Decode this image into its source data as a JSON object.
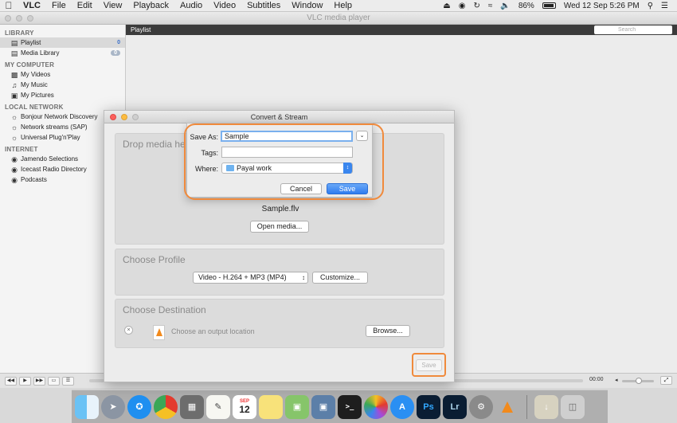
{
  "menubar": {
    "items": [
      "VLC",
      "File",
      "Edit",
      "View",
      "Playback",
      "Audio",
      "Video",
      "Subtitles",
      "Window",
      "Help"
    ],
    "battery": "86%",
    "clock": "Wed 12 Sep  5:26 PM"
  },
  "vlc": {
    "title": "VLC media player",
    "sidebar": {
      "library_header": "LIBRARY",
      "playlist": "Playlist",
      "playlist_count": "0",
      "media_library": "Media Library",
      "media_library_count": "0",
      "computer_header": "MY COMPUTER",
      "videos": "My Videos",
      "music": "My Music",
      "pictures": "My Pictures",
      "network_header": "LOCAL NETWORK",
      "bonjour": "Bonjour Network Discovery",
      "sap": "Network streams (SAP)",
      "upnp": "Universal Plug'n'Play",
      "internet_header": "INTERNET",
      "jamendo": "Jamendo Selections",
      "icecast": "Icecast Radio Directory",
      "podcasts": "Podcasts"
    },
    "playlist_label": "Playlist",
    "search_placeholder": "Search",
    "time": "00:00"
  },
  "convert": {
    "title": "Convert & Stream",
    "drop_header": "Drop media he",
    "filename": "Sample.flv",
    "open_media": "Open media...",
    "profile_header": "Choose Profile",
    "profile_value": "Video - H.264 + MP3 (MP4)",
    "customize": "Customize...",
    "destination_header": "Choose Destination",
    "destination_hint": "Choose an output location",
    "browse": "Browse...",
    "save": "Save"
  },
  "save_sheet": {
    "save_as_label": "Save As:",
    "save_as_value": "Sample",
    "tags_label": "Tags:",
    "tags_value": "",
    "where_label": "Where:",
    "where_value": "Payal work",
    "cancel": "Cancel",
    "save": "Save"
  },
  "dock": {
    "apps": [
      "finder-icon",
      "launchpad-icon",
      "safari-icon",
      "chrome-icon",
      "calculator-icon",
      "textedit-icon",
      "calendar-icon",
      "notes-icon",
      "preview-icon",
      "image-capture-icon",
      "terminal-icon",
      "photos-icon",
      "app-store-icon",
      "photoshop-icon",
      "lightroom-icon",
      "system-preferences-icon",
      "vlc-icon",
      "downloads-icon",
      "trash-icon"
    ],
    "calendar_day": "12",
    "calendar_month": "SEP",
    "ps_label": "Ps",
    "lr_label": "Lr",
    "terminal_label": ">_"
  }
}
